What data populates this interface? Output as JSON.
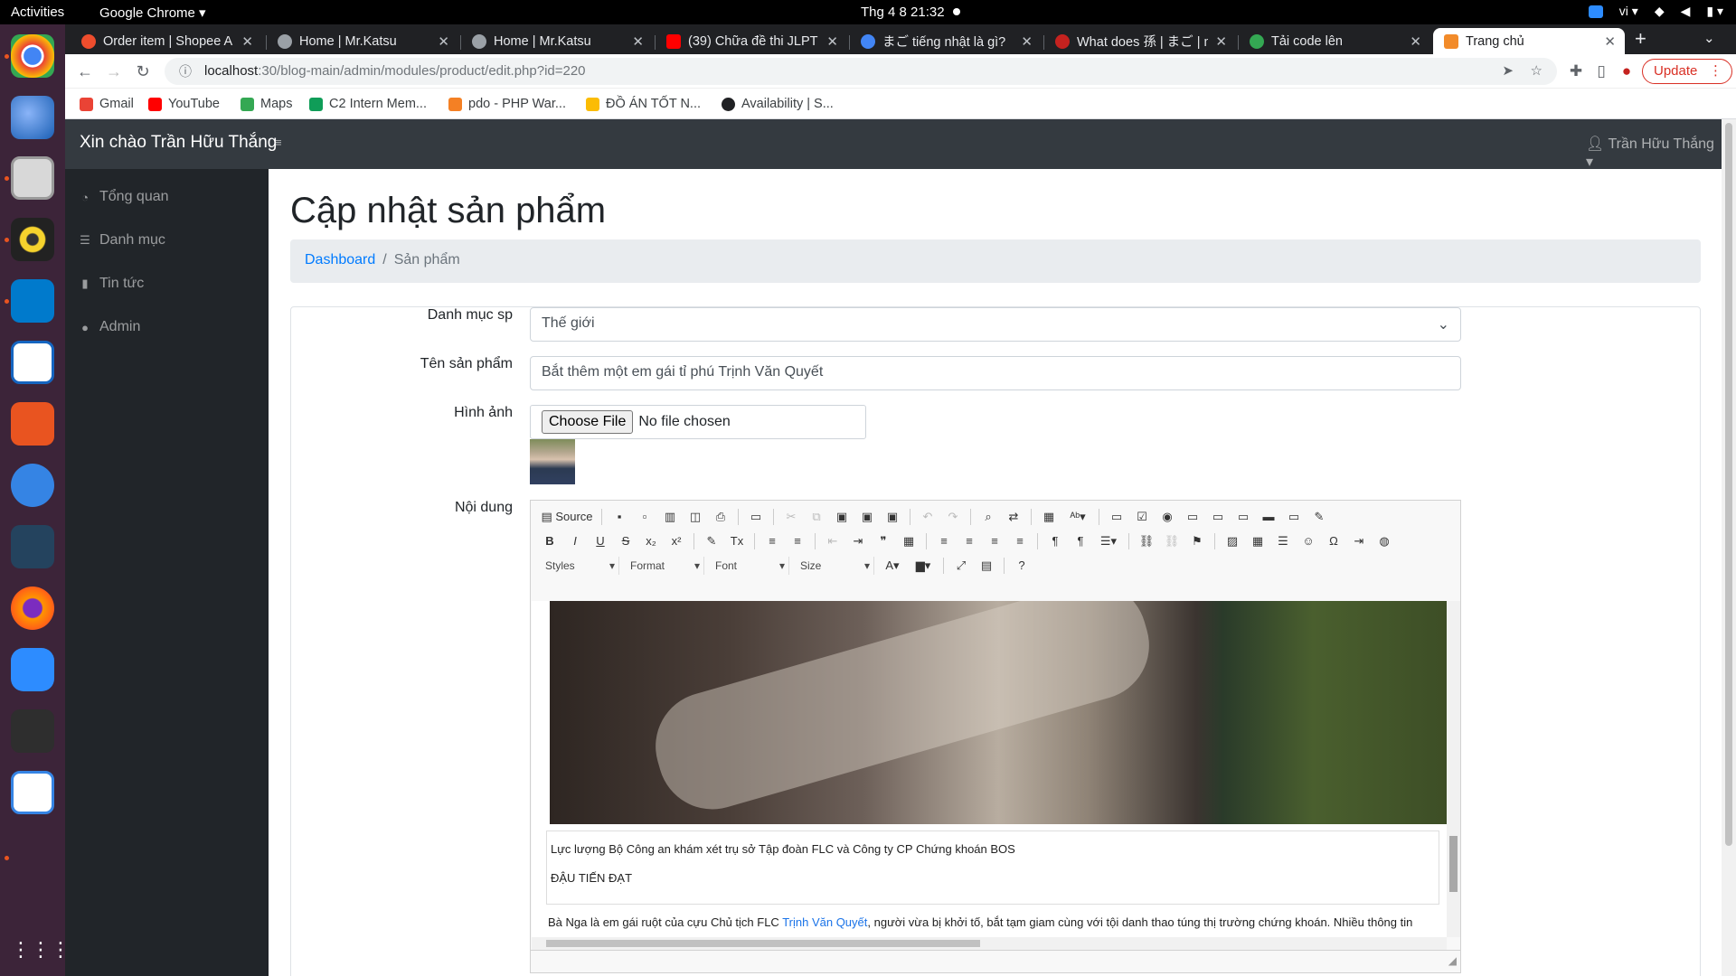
{
  "topbar": {
    "activities": "Activities",
    "app_name": "Google Chrome",
    "clock": "Thg 4 8  21:32",
    "lang": "vi"
  },
  "tabs": [
    {
      "title": "Order item | Shopee A",
      "favicon_color": "#ee4d2d"
    },
    {
      "title": "Home | Mr.Katsu",
      "favicon_color": "#9aa0a6"
    },
    {
      "title": "Home | Mr.Katsu",
      "favicon_color": "#9aa0a6"
    },
    {
      "title": "(39) Chữa đề thi JLPT",
      "favicon_color": "#ff0000"
    },
    {
      "title": "まご tiếng nhật là gì?",
      "favicon_color": "#4285f4"
    },
    {
      "title": "What does 孫 | まご | m",
      "favicon_color": "#c5221f"
    },
    {
      "title": "Tải code lên",
      "favicon_color": "#34a853"
    },
    {
      "title": "Trang chủ",
      "favicon_color": "#f28b2a"
    }
  ],
  "address": {
    "host": "localhost",
    "path": ":30/blog-main/admin/modules/product/edit.php?id=220"
  },
  "update_label": "Update",
  "bookmarks": [
    {
      "label": "Gmail",
      "color": "#ea4335"
    },
    {
      "label": "YouTube",
      "color": "#ff0000"
    },
    {
      "label": "Maps",
      "color": "#34a853"
    },
    {
      "label": "C2 Intern Mem...",
      "color": "#0f9d58"
    },
    {
      "label": "pdo - PHP War...",
      "color": "#f48024"
    },
    {
      "label": "ĐỒ ÁN TỐT N...",
      "color": "#fbbc04"
    },
    {
      "label": "Availability | S...",
      "color": "#202124"
    }
  ],
  "admin": {
    "brand": "Xin chào Trần Hữu Thắng",
    "user": "Trần Hữu Thắng"
  },
  "sidebar": [
    {
      "label": "Tổng quan",
      "icon": "dashboard-icon"
    },
    {
      "label": "Danh mục",
      "icon": "list-icon"
    },
    {
      "label": "Tin tức",
      "icon": "book-icon"
    },
    {
      "label": "Admin",
      "icon": "user-icon"
    }
  ],
  "page": {
    "title": "Cập nhật sản phẩm"
  },
  "breadcrumb": {
    "home": "Dashboard",
    "current": "Sản phẩm"
  },
  "form": {
    "category_label": "Danh mục sp",
    "category_value": "Thế giới",
    "name_label": "Tên sản phẩm",
    "name_value": "Bắt thêm một em gái tỉ phú Trịnh Văn Quyết",
    "image_label": "Hình ảnh",
    "file_button": "Choose File",
    "file_status": "No file chosen",
    "content_label": "Nội dung"
  },
  "editor": {
    "source_label": "Source",
    "combos": [
      "Styles",
      "Format",
      "Font",
      "Size"
    ],
    "caption_line1": "Lực lượng Bộ Công an khám xét trụ sở Tập đoàn FLC và Công ty CP Chứng khoán BOS",
    "caption_line2": "ĐẬU TIẾN ĐẠT",
    "body_pre": "Bà Nga là em gái ruột của cựu Chủ tịch FLC ",
    "body_link": "Trịnh Văn Quyết",
    "body_post": ", người vừa bị khởi tố, bắt tạm giam cùng với tội danh thao túng thị trường chứng khoán. Nhiều thông tin"
  }
}
